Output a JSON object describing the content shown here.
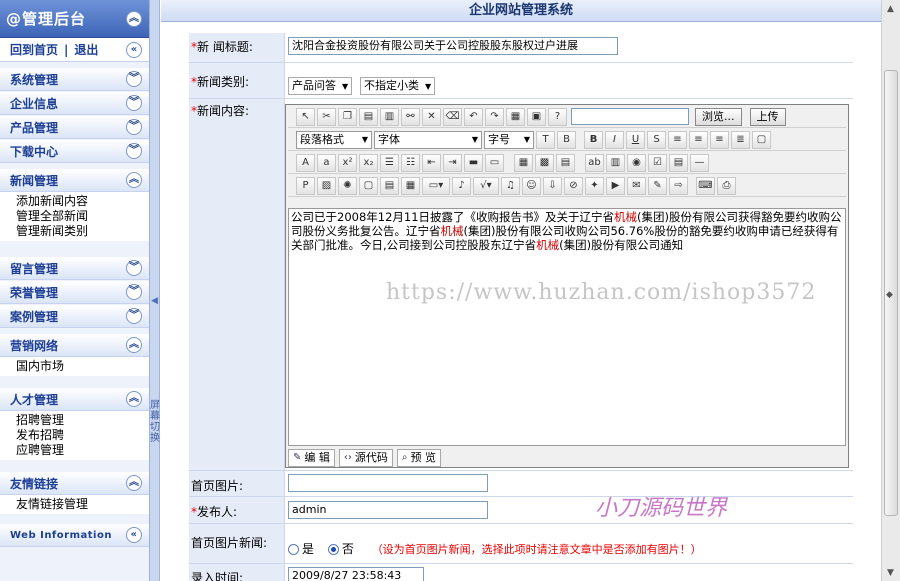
{
  "sidebar": {
    "title": "@管理后台",
    "home": "回到首页",
    "separator": "|",
    "logout": "退出",
    "groups": [
      {
        "label": "系统管理",
        "expanded": false,
        "items": []
      },
      {
        "label": "企业信息",
        "expanded": false,
        "items": []
      },
      {
        "label": "产品管理",
        "expanded": false,
        "items": []
      },
      {
        "label": "下载中心",
        "expanded": false,
        "items": []
      },
      {
        "label": "新闻管理",
        "expanded": true,
        "items": [
          "添加新闻内容",
          "管理全部新闻",
          "管理新闻类别"
        ]
      },
      {
        "label": "留言管理",
        "expanded": false,
        "items": []
      },
      {
        "label": "荣誉管理",
        "expanded": false,
        "items": []
      },
      {
        "label": "案例管理",
        "expanded": false,
        "items": []
      },
      {
        "label": "营销网络",
        "expanded": true,
        "items": [
          "国内市场"
        ]
      },
      {
        "label": "人才管理",
        "expanded": true,
        "items": [
          "招聘管理",
          "发布招聘",
          "应聘管理"
        ]
      },
      {
        "label": "友情链接",
        "expanded": true,
        "items": [
          "友情链接管理"
        ]
      },
      {
        "label": "Web Information",
        "expanded": false,
        "items": []
      }
    ]
  },
  "splitter": {
    "label": "屏幕切换"
  },
  "main": {
    "page_title": "企业网站管理系统",
    "required_mark": "*",
    "fields": {
      "title_label": "新 闻标题:",
      "title_value": "沈阳合金投资股份有限公司关于公司控股股东股权过户进展",
      "category_label": "新闻类别:",
      "category_value": "产品问答",
      "subcategory_value": "不指定小类",
      "content_label": "新闻内容:",
      "home_image_label": "首页图片:",
      "home_image_value": "",
      "publisher_label": "发布人:",
      "publisher_value": "admin",
      "home_news_label": "首页图片新闻:",
      "home_news_yes": "是",
      "home_news_no": "否",
      "home_news_note": "（设为首页图片新闻，选择此项时请注意文章中是否添加有图片！）",
      "date_label": "录入时间:",
      "date_value": "2009/8/27 23:58:43"
    }
  },
  "editor": {
    "browse_label": "浏览...",
    "upload_label": "上传",
    "paragraph_format": "段落格式",
    "font_family": "字体",
    "font_size": "字号",
    "tab_edit": "编 辑",
    "tab_source": "源代码",
    "tab_preview": "预 览",
    "content": [
      {
        "t": "公司已于2008年12月11日披露了《收购报告书》及关于辽宁省"
      },
      {
        "t": "机械",
        "hl": true
      },
      {
        "t": "(集团)股份有限公司获得豁免要约收购公司股份义务批复公告。辽宁省"
      },
      {
        "t": "机械",
        "hl": true
      },
      {
        "t": "(集团)股份有限公司收购公司56.76%股份的豁免要约收购申请已经获得有关部门批准。今日,公司接到公司控股股东辽宁省"
      },
      {
        "t": "机械",
        "hl": true
      },
      {
        "t": "(集团)股份有限公司通知"
      }
    ]
  },
  "overlays": {
    "watermark": "https://www.huzhan.com/ishop3572",
    "signature": "小刀源码世界"
  }
}
